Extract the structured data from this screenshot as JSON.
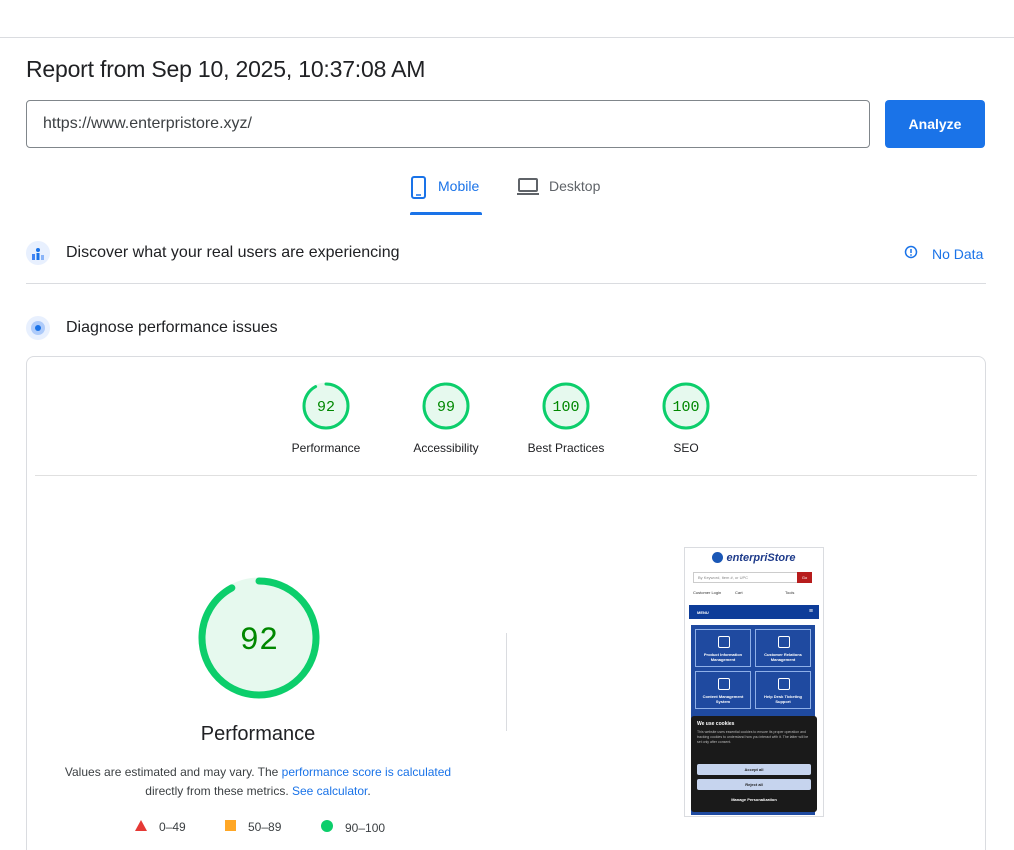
{
  "report": {
    "title": "Report from Sep 10, 2025, 10:37:08 AM"
  },
  "search": {
    "url": "https://www.enterpristore.xyz/",
    "analyze_label": "Analyze"
  },
  "tabs": [
    {
      "label": "Mobile",
      "icon": "phone-icon",
      "active": true
    },
    {
      "label": "Desktop",
      "icon": "laptop-icon",
      "active": false
    }
  ],
  "real_users": {
    "title": "Discover what your real users are experiencing",
    "status": "No Data"
  },
  "diagnose": {
    "title": "Diagnose performance issues"
  },
  "categories": [
    {
      "label": "Performance",
      "score": "92"
    },
    {
      "label": "Accessibility",
      "score": "99"
    },
    {
      "label": "Best Practices",
      "score": "100"
    },
    {
      "label": "SEO",
      "score": "100"
    }
  ],
  "performance": {
    "score": "92",
    "label": "Performance",
    "note_prefix": "Values are estimated and may vary. The ",
    "note_link1": "performance score is calculated",
    "note_middle": "directly from these metrics. ",
    "note_link2": "See calculator",
    "note_suffix": "."
  },
  "legend": [
    {
      "range": "0–49",
      "color": "#e53935"
    },
    {
      "range": "50–89",
      "color": "#ffa726"
    },
    {
      "range": "90–100",
      "color": "#0cce6b"
    }
  ],
  "screenshot": {
    "brand": "enterpriStore",
    "search_placeholder": "By Keyword, Item #, or UPC",
    "go": "Go",
    "links": [
      "Customer Login",
      "Cart",
      "Tools"
    ],
    "menu": "MENU",
    "tiles": [
      "Product Information Management",
      "Customer Relations Management",
      "Content Management System",
      "Help Desk Ticketing Support"
    ],
    "cookie_title": "We use cookies",
    "cookie_text": "This website uses essential cookies to ensure its proper operation and tracking cookies to understand how you interact with it. The latter will be set only after consent.",
    "accept": "Accept all",
    "reject": "Reject all",
    "manage": "Manage Personalization"
  },
  "colors": {
    "accent": "#1a73e8",
    "pass": "#0cce6b",
    "pass_text": "#008800",
    "pass_fill": "#e6f9ee"
  }
}
